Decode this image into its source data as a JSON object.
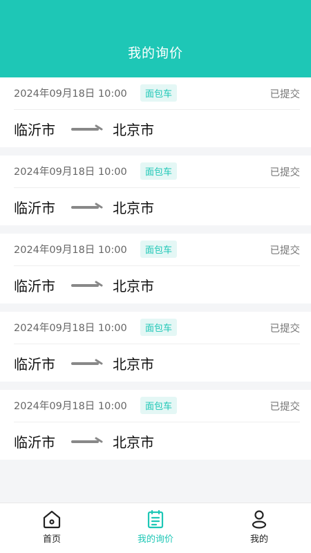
{
  "header": {
    "title": "我的询价"
  },
  "inquiries": [
    {
      "date": "2024年09月18日 10:00",
      "vehicle": "面包车",
      "status": "已提交",
      "from": "临沂市",
      "to": "北京市"
    },
    {
      "date": "2024年09月18日 10:00",
      "vehicle": "面包车",
      "status": "已提交",
      "from": "临沂市",
      "to": "北京市"
    },
    {
      "date": "2024年09月18日 10:00",
      "vehicle": "面包车",
      "status": "已提交",
      "from": "临沂市",
      "to": "北京市"
    },
    {
      "date": "2024年09月18日 10:00",
      "vehicle": "面包车",
      "status": "已提交",
      "from": "临沂市",
      "to": "北京市"
    },
    {
      "date": "2024年09月18日 10:00",
      "vehicle": "面包车",
      "status": "已提交",
      "from": "临沂市",
      "to": "北京市"
    }
  ],
  "tabbar": {
    "items": [
      {
        "label": "首页",
        "icon": "home-icon"
      },
      {
        "label": "我的询价",
        "icon": "clipboard-icon",
        "active": true
      },
      {
        "label": "我的",
        "icon": "user-icon"
      }
    ]
  },
  "colors": {
    "accent": "#1ec7b6",
    "tag_bg": "#e4f7f5",
    "arrow": "#888888"
  }
}
